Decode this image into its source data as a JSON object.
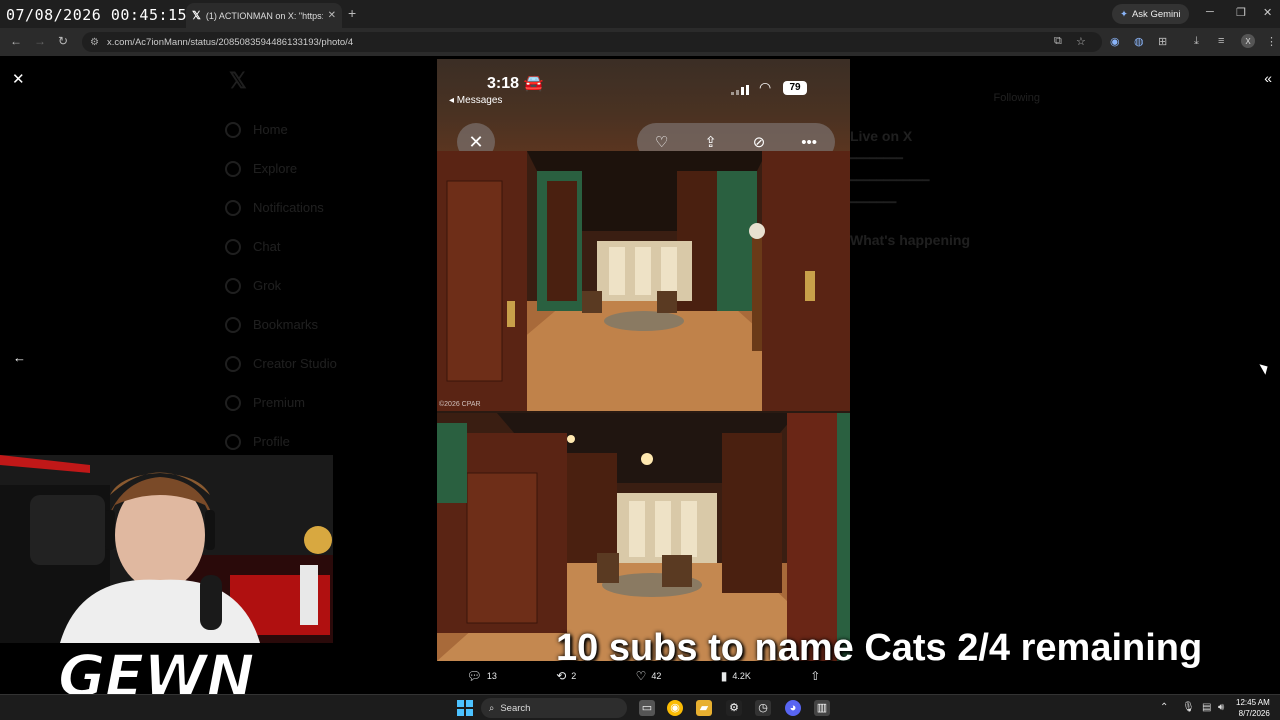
{
  "stream": {
    "timestamp": "07/08/2026 00:45:15",
    "sub_goal": "10 subs to name Cats 2/4 remaining",
    "logo": "GEWN"
  },
  "browser": {
    "tab": {
      "title": "(1) ACTIONMAN on X: \"https://",
      "icon": "x-logo"
    },
    "new_tab": "+",
    "ask_gemini": "Ask Gemini",
    "url": "x.com/Ac7ionMann/status/2085083594486133193/photo/4",
    "profile_initial": "X"
  },
  "media_viewer": {
    "phone": {
      "time": "3:18",
      "back_label": "◂ Messages",
      "battery": "79",
      "copyright": "©2026 CPAR"
    },
    "tweet_actions": {
      "replies": "13",
      "reposts": "2",
      "likes": "42",
      "views": "4.2K"
    }
  },
  "background_nav": [
    "Home",
    "Explore",
    "Notifications",
    "Chat",
    "Grok",
    "Bookmarks",
    "Creator Studio",
    "Premium",
    "Profile"
  ],
  "background_right": {
    "follow": "Following",
    "live_heading": "Live on X",
    "trending_heading": "What's happening"
  },
  "taskbar": {
    "search_label": "Search",
    "time": "12:45 AM",
    "date": "8/7/2026"
  },
  "colors": {
    "accent_start": "#4cc2ff",
    "x_blue": "#1d9bf0"
  }
}
